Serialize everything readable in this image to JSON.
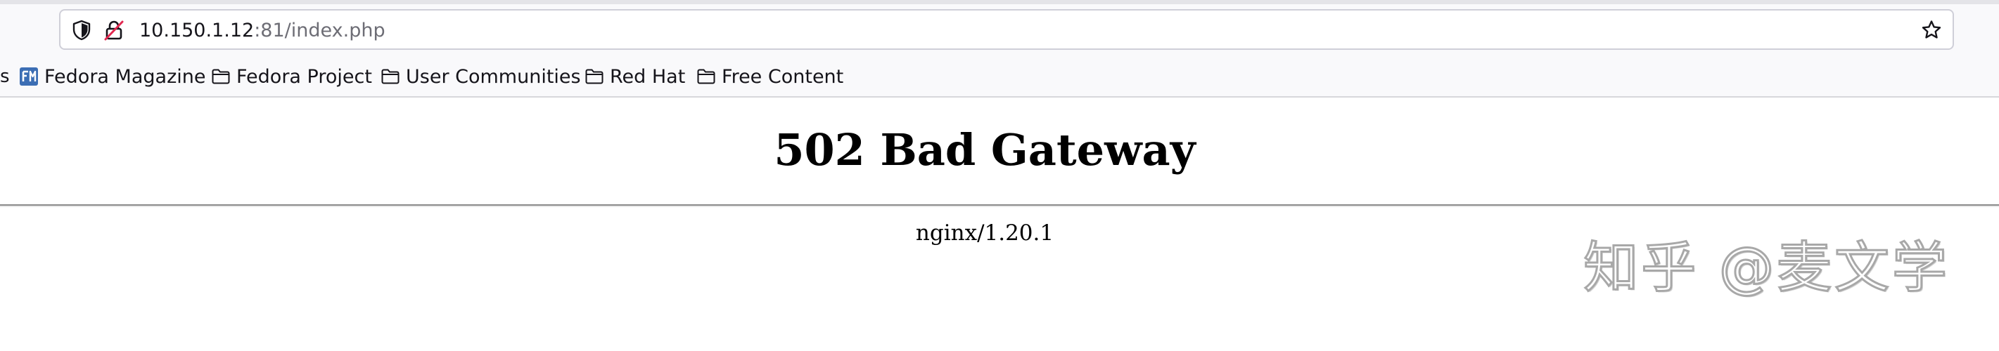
{
  "urlbar": {
    "host": "10.150.1.12",
    "rest": ":81/index.php"
  },
  "icons": {
    "shield": "tracking-protection-shield-icon",
    "lock": "insecure-connection-lock-icon",
    "star": "bookmark-star-icon",
    "folder": "folder-icon",
    "fedora_magazine": "fedora-magazine-favicon"
  },
  "bookmarks": {
    "overflow_text": "s",
    "items": [
      {
        "label": "Fedora Magazine",
        "icon": "fedora-magazine-favicon"
      },
      {
        "label": "Fedora Project",
        "icon": "folder-icon"
      },
      {
        "label": "User Communities",
        "icon": "folder-icon"
      },
      {
        "label": "Red Hat",
        "icon": "folder-icon"
      },
      {
        "label": "Free Content",
        "icon": "folder-icon"
      }
    ]
  },
  "page": {
    "title": "502 Bad Gateway",
    "server": "nginx/1.20.1"
  },
  "watermark": {
    "text": "知乎 @麦文学"
  },
  "colors": {
    "chrome_bg": "#f9f9fb",
    "urlbar_border": "#cfcfd8",
    "url_host": "#15141a",
    "url_rest": "#6d6d75",
    "lock_alert": "#e22850",
    "fedora_blue": "#3c6eb4"
  }
}
